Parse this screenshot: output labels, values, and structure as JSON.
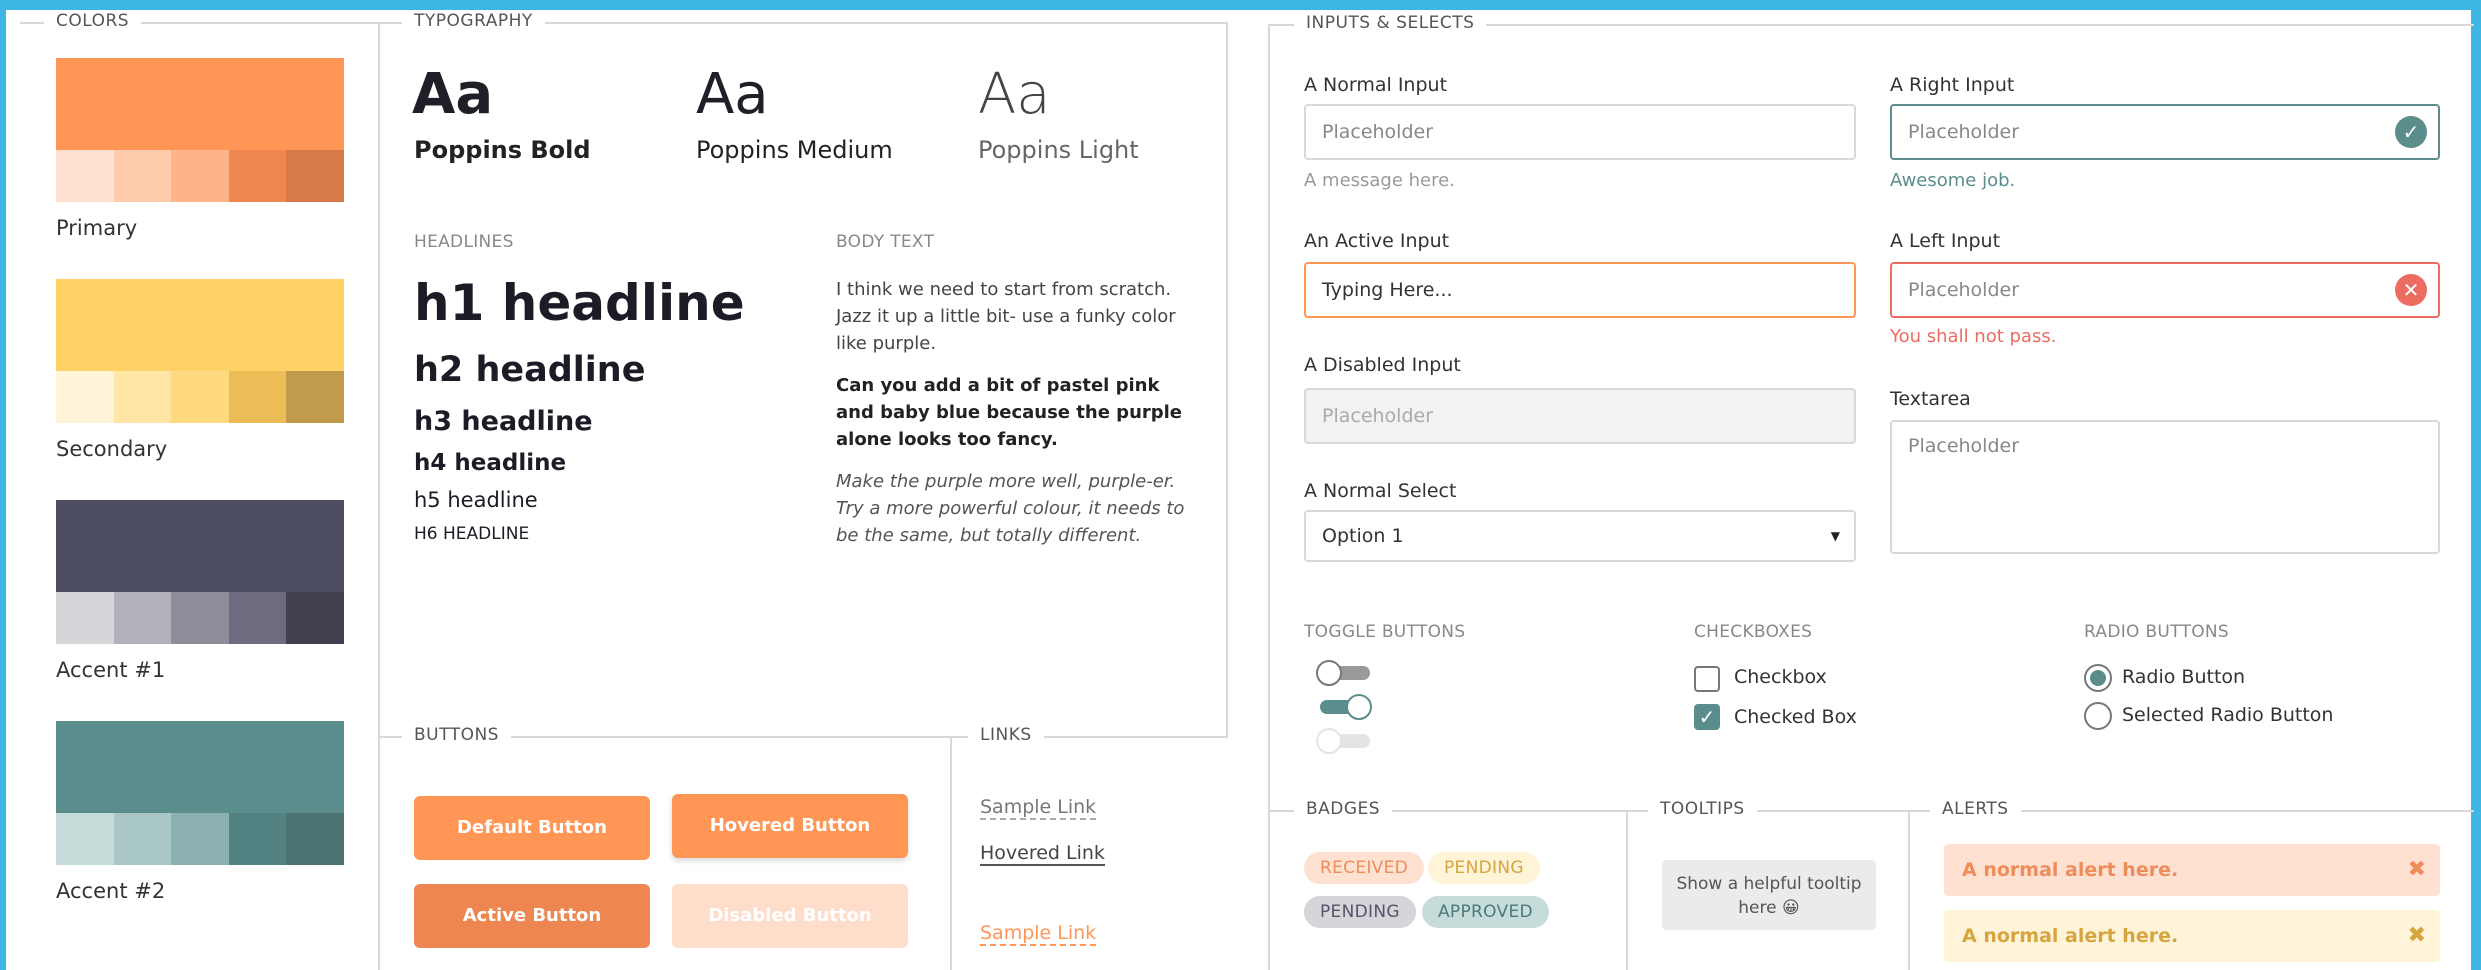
{
  "colors": {
    "label": "COLORS",
    "swatches": [
      {
        "name": "Primary",
        "main": "#ff9656",
        "shades": [
          "#ffe1d2",
          "#ffcbad",
          "#ffb388",
          "#ef8850",
          "#d57a48"
        ]
      },
      {
        "name": "Secondary",
        "main": "#ffd267",
        "shades": [
          "#fff4d7",
          "#ffe6a5",
          "#ffd980",
          "#ecbc57",
          "#c19b4c"
        ]
      },
      {
        "name": "Accent #1",
        "main": "#4d4d63",
        "shades": [
          "#d5d5da",
          "#b1b1bb",
          "#8e8e9b",
          "#6c6c7e",
          "#40404f"
        ]
      },
      {
        "name": "Accent #2",
        "main": "#5a8d8c",
        "shades": [
          "#c6dcdb",
          "#a8c7c6",
          "#8bb1b0",
          "#528281",
          "#4a7372"
        ]
      }
    ]
  },
  "typography": {
    "label": "TYPOGRAPHY",
    "samples": [
      {
        "aa": "Aa",
        "label": "Poppins Bold"
      },
      {
        "aa": "Aa",
        "label": "Poppins Medium"
      },
      {
        "aa": "Aa",
        "label": "Poppins Light"
      }
    ],
    "headlines_label": "HEADLINES",
    "headlines": [
      "h1 headline",
      "h2 headline",
      "h3 headline",
      "h4 headline",
      "h5 headline",
      "H6 HEADLINE"
    ],
    "body_label": "BODY TEXT",
    "body": [
      "I think we need to start from scratch. Jazz it up a little bit- use a funky color like purple.",
      "Can you add a bit of pastel pink and baby blue because the purple alone looks too fancy.",
      "Make the purple more well, purple-er. Try a more powerful colour, it needs to be the same, but totally different."
    ]
  },
  "buttons": {
    "label": "BUTTONS",
    "default": "Default Button",
    "hovered": "Hovered Button",
    "active": "Active Button",
    "disabled": "Disabled Button"
  },
  "links": {
    "label": "LINKS",
    "items": [
      "Sample Link",
      "Hovered Link",
      "Sample Link"
    ]
  },
  "inputs": {
    "label": "INPUTS & SELECTS",
    "normal": {
      "label": "A Normal Input",
      "placeholder": "Placeholder",
      "helper": "A message here."
    },
    "right": {
      "label": "A Right Input",
      "placeholder": "Placeholder",
      "helper": "Awesome job."
    },
    "active": {
      "label": "An Active Input",
      "value": "Typing Here..."
    },
    "left": {
      "label": "A Left Input",
      "placeholder": "Placeholder",
      "helper": "You shall not pass."
    },
    "disabled": {
      "label": "A Disabled Input",
      "placeholder": "Placeholder"
    },
    "textarea": {
      "label": "Textarea",
      "placeholder": "Placeholder"
    },
    "select": {
      "label": "A Normal Select",
      "value": "Option 1"
    }
  },
  "toggles": {
    "label": "TOGGLE BUTTONS"
  },
  "checkboxes": {
    "label": "CHECKBOXES",
    "items": [
      "Checkbox",
      "Checked Box"
    ]
  },
  "radios": {
    "label": "RADIO BUTTONS",
    "items": [
      "Radio Button",
      "Selected Radio Button"
    ]
  },
  "badges": {
    "label": "BADGES",
    "items": [
      "RECEIVED",
      "PENDING",
      "PENDING",
      "APPROVED"
    ]
  },
  "tooltips": {
    "label": "TOOLTIPS",
    "text": "Show a helpful tooltip here 😀"
  },
  "alerts": {
    "label": "ALERTS",
    "items": [
      "A normal alert here.",
      "A normal alert here."
    ]
  }
}
